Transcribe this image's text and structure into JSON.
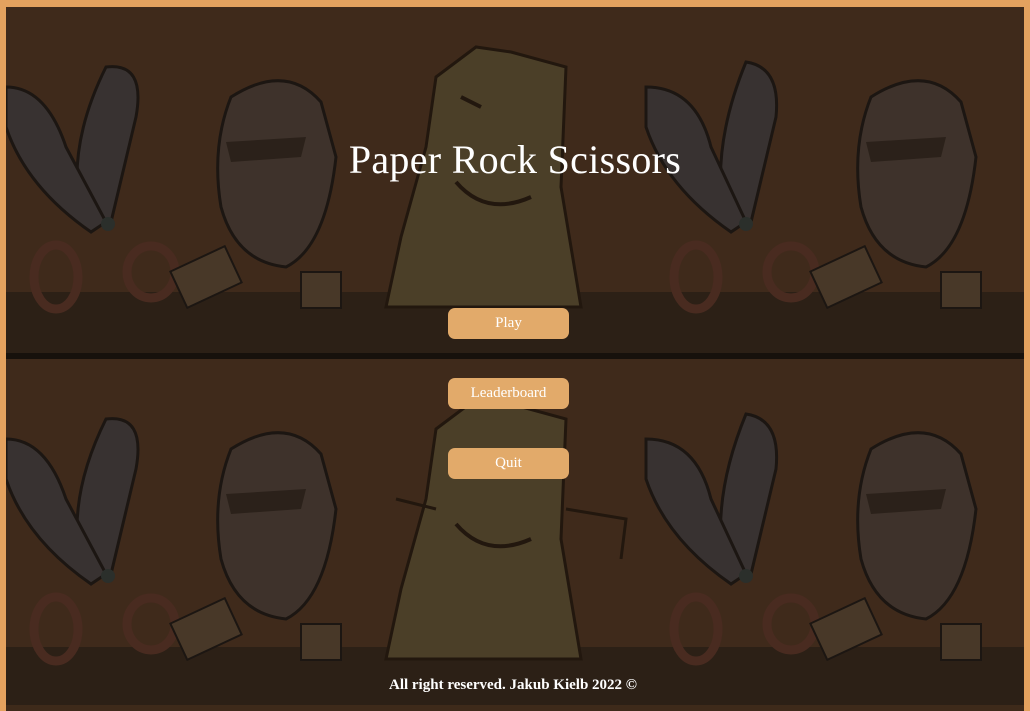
{
  "page": {
    "title": "Paper Rock Scissors"
  },
  "menu": {
    "play_label": "Play",
    "leaderboard_label": "Leaderboard",
    "quit_label": "Quit"
  },
  "footer": {
    "text": "All right reserved. Jakub Kielb 2022 ©"
  },
  "colors": {
    "frame": "#e4a25f",
    "background": "#4a3220",
    "button": "#e2aa6a",
    "text": "#ffffff"
  },
  "background_art": {
    "characters": [
      "scissors-character",
      "rock-character",
      "paper-character"
    ]
  }
}
